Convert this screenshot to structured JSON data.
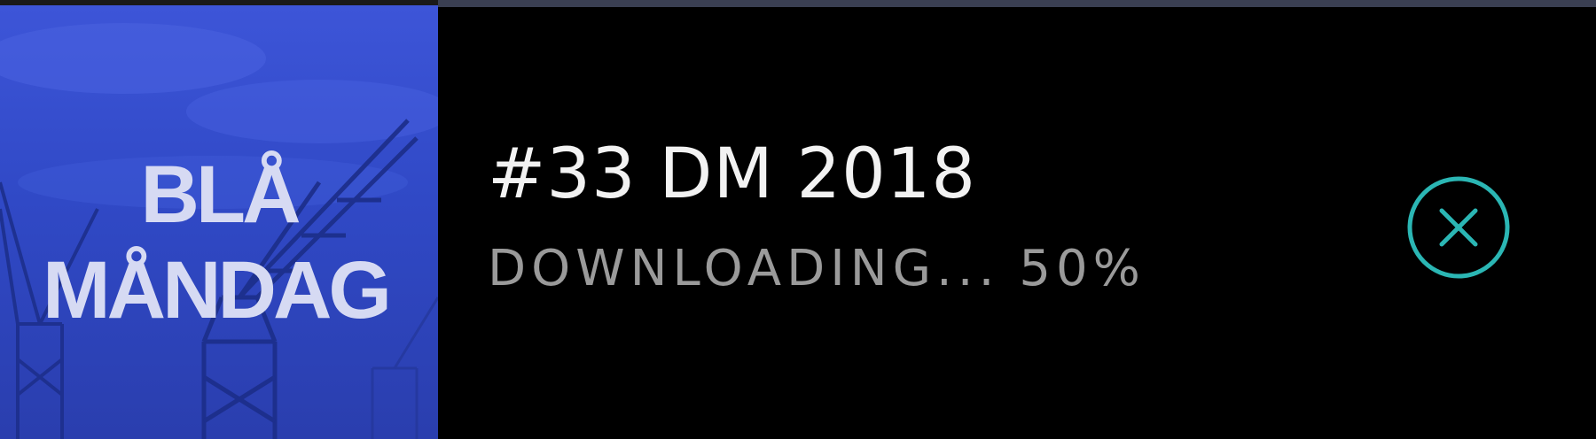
{
  "artwork": {
    "line1": "BLÅ",
    "line2": "MÅNDAG",
    "background_color": "#3049c6",
    "text_color": "#d6daf3"
  },
  "download": {
    "title": "#33 DM 2018",
    "status_label": "DOWNLOADING...",
    "progress_text": "50%",
    "progress": 0.5
  },
  "cancel_button": {
    "icon": "close-circle-icon",
    "color": "#2bb6b4"
  }
}
